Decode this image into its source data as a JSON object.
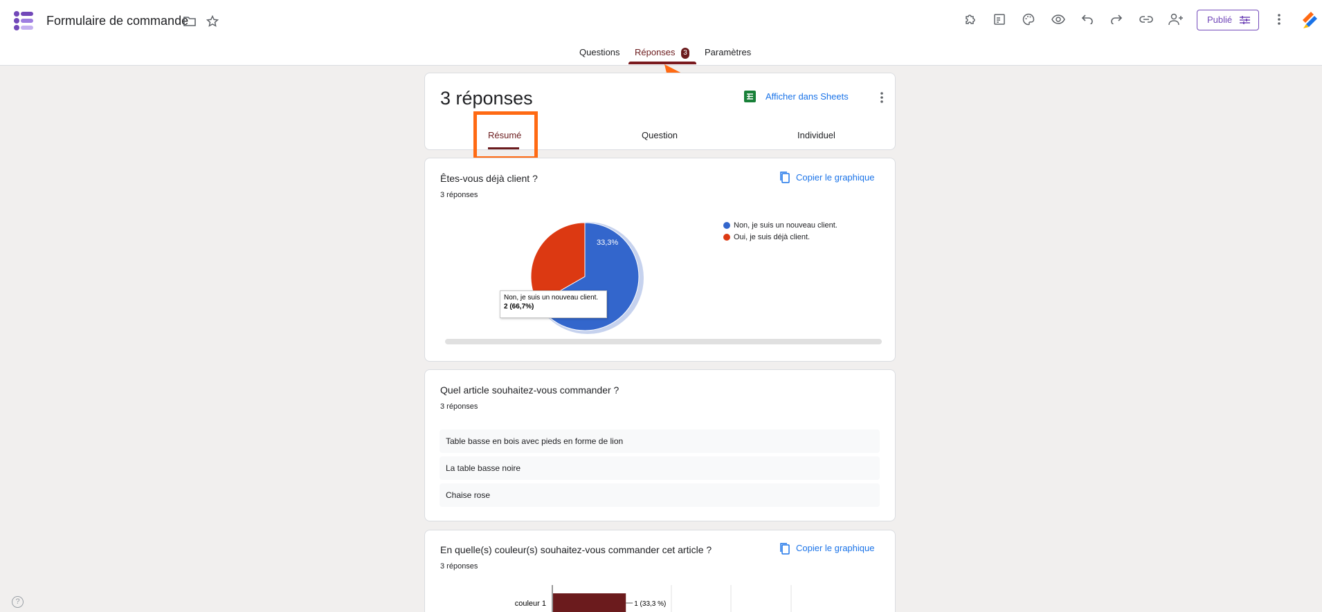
{
  "header": {
    "title": "Formulaire de commande",
    "publish_label": "Publié"
  },
  "tabs": [
    {
      "label": "Questions"
    },
    {
      "label": "Réponses",
      "badge": "3"
    },
    {
      "label": "Paramètres"
    }
  ],
  "summary": {
    "title": "3 réponses",
    "sheets_link": "Afficher dans Sheets",
    "subtabs": [
      "Résumé",
      "Question",
      "Individuel"
    ]
  },
  "q1": {
    "title": "Êtes-vous déjà client ?",
    "count": "3 réponses",
    "copy_label": "Copier le graphique",
    "tooltip_line1": "Non, je suis un nouveau client.",
    "tooltip_line2": "2 (66,7%)"
  },
  "q2": {
    "title": "Quel article souhaitez-vous commander ?",
    "count": "3 réponses",
    "answers": [
      "Table basse en bois avec pieds en forme de lion",
      "La table basse noire",
      "Chaise rose"
    ]
  },
  "q3": {
    "title": "En quelle(s) couleur(s) souhaitez-vous commander cet article ?",
    "count": "3 réponses",
    "copy_label": "Copier le graphique"
  },
  "chart_data": [
    {
      "type": "pie",
      "categories": [
        "Non, je suis un nouveau client.",
        "Oui, je suis déjà client."
      ],
      "values": [
        66.7,
        33.3
      ],
      "slice_labels": [
        "",
        "33,3%"
      ],
      "colors": [
        "#3366cc",
        "#dc3912"
      ],
      "legend": "right"
    },
    {
      "type": "bar",
      "categories": [
        "couleur 1"
      ],
      "values": [
        1
      ],
      "data_labels": [
        "1 (33,3 %)"
      ],
      "colors": [
        "#6b1b1d"
      ]
    }
  ],
  "colors": {
    "accent": "#6b1b1d",
    "link": "#1a73e8",
    "publish": "#7248b9",
    "annotation": "#ff6a13"
  }
}
